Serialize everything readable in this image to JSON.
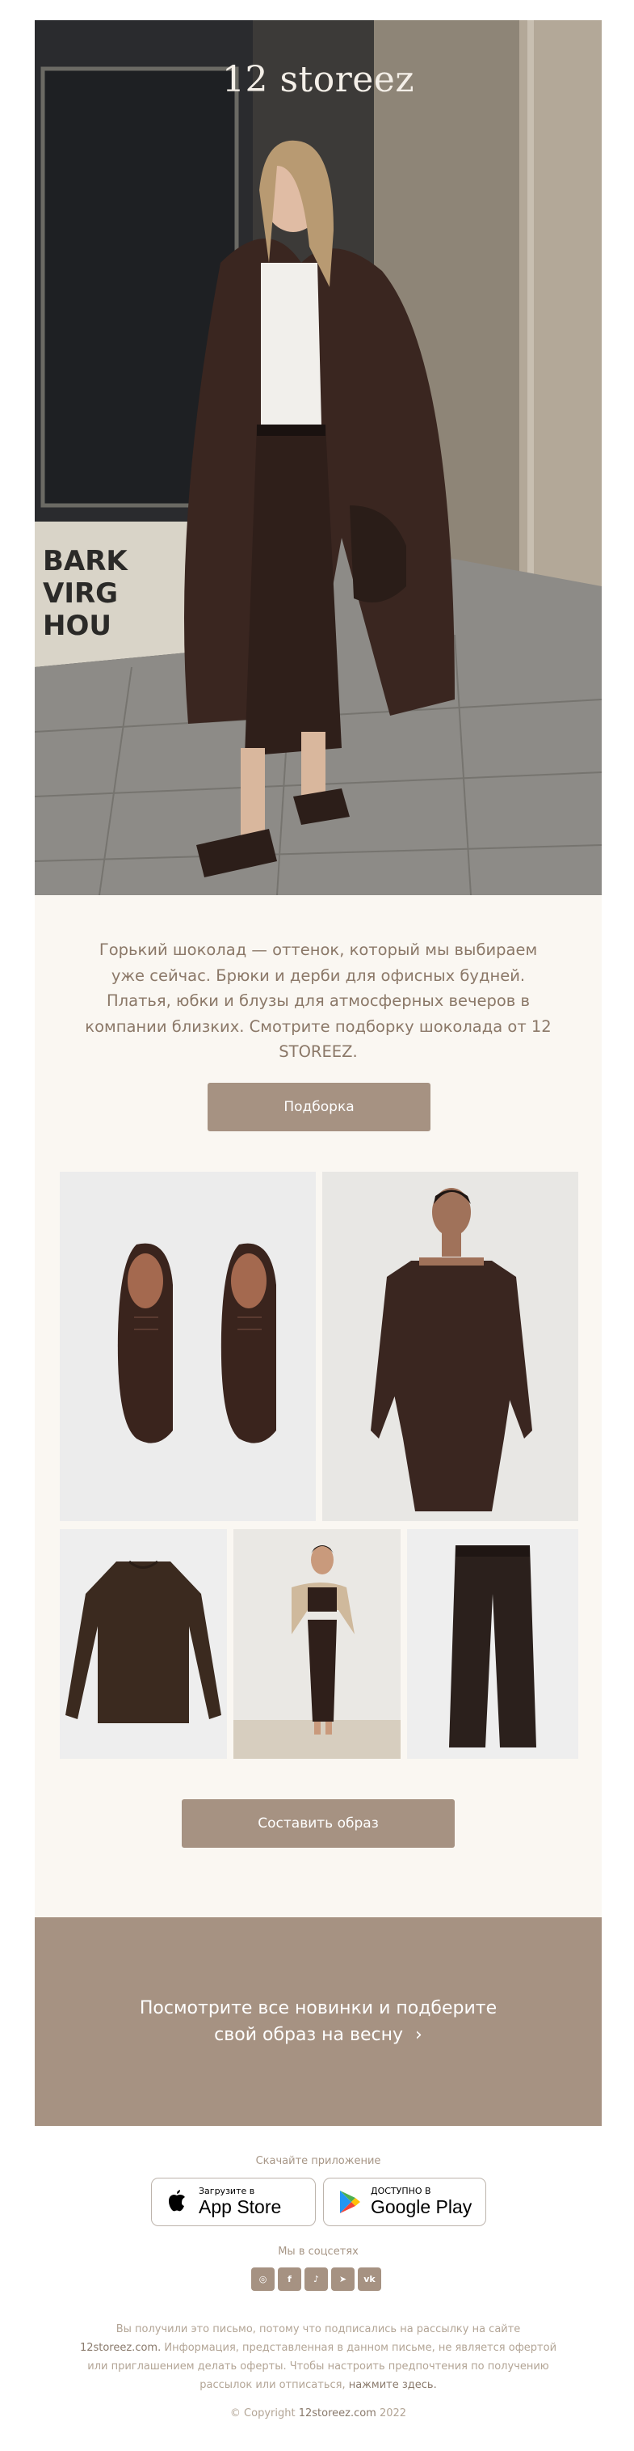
{
  "hero": {
    "brand": "12 storeez"
  },
  "intro": {
    "text": "Горький шоколад — оттенок, который мы выбираем уже сейчас. Брюки и дерби для офисных будней. Платья, юбки и блузы для атмосферных вечеров в компании близких. Смотрите подборку шоколада от 12 STOREEZ.",
    "button_label": "Подборка"
  },
  "products": {
    "items": [
      {
        "name": "derby-shoes"
      },
      {
        "name": "off-shoulder-dress"
      },
      {
        "name": "blouse"
      },
      {
        "name": "top-and-skirt"
      },
      {
        "name": "trousers"
      }
    ],
    "button_label": "Составить образ"
  },
  "banner": {
    "line1": "Посмотрите все новинки и подберите",
    "line2": "свой образ на весну",
    "arrow": "›"
  },
  "footer": {
    "app_label": "Скачайте приложение",
    "app_store": {
      "small": "Загрузите в",
      "big": "App Store"
    },
    "google_play": {
      "small": "ДОСТУПНО В",
      "big": "Google Play"
    },
    "social_label": "Мы в соцсетях",
    "socials": [
      {
        "icon": "instagram-icon",
        "glyph": "◎"
      },
      {
        "icon": "facebook-icon",
        "glyph": "f"
      },
      {
        "icon": "tiktok-icon",
        "glyph": "♪"
      },
      {
        "icon": "telegram-icon",
        "glyph": "➤"
      },
      {
        "icon": "vk-icon",
        "glyph": "vk"
      }
    ],
    "legal_part1": "Вы получили это письмо, потому что подписались на рассылку на сайте ",
    "legal_link1": "12storeez.com.",
    "legal_part2": " Информация, представленная в данном письме, не является офертой или приглашением делать оферты. Чтобы настроить предпочтения по получению рассылок или отписаться, ",
    "legal_link2": "нажмите здесь.",
    "copyright_prefix": "© Copyright ",
    "copyright_link": "12storeez.com",
    "copyright_year": " 2022"
  },
  "colors": {
    "accent": "#a69282",
    "cream": "#faf7f2",
    "text": "#8b7868",
    "chocolate": "#3b2a24"
  }
}
